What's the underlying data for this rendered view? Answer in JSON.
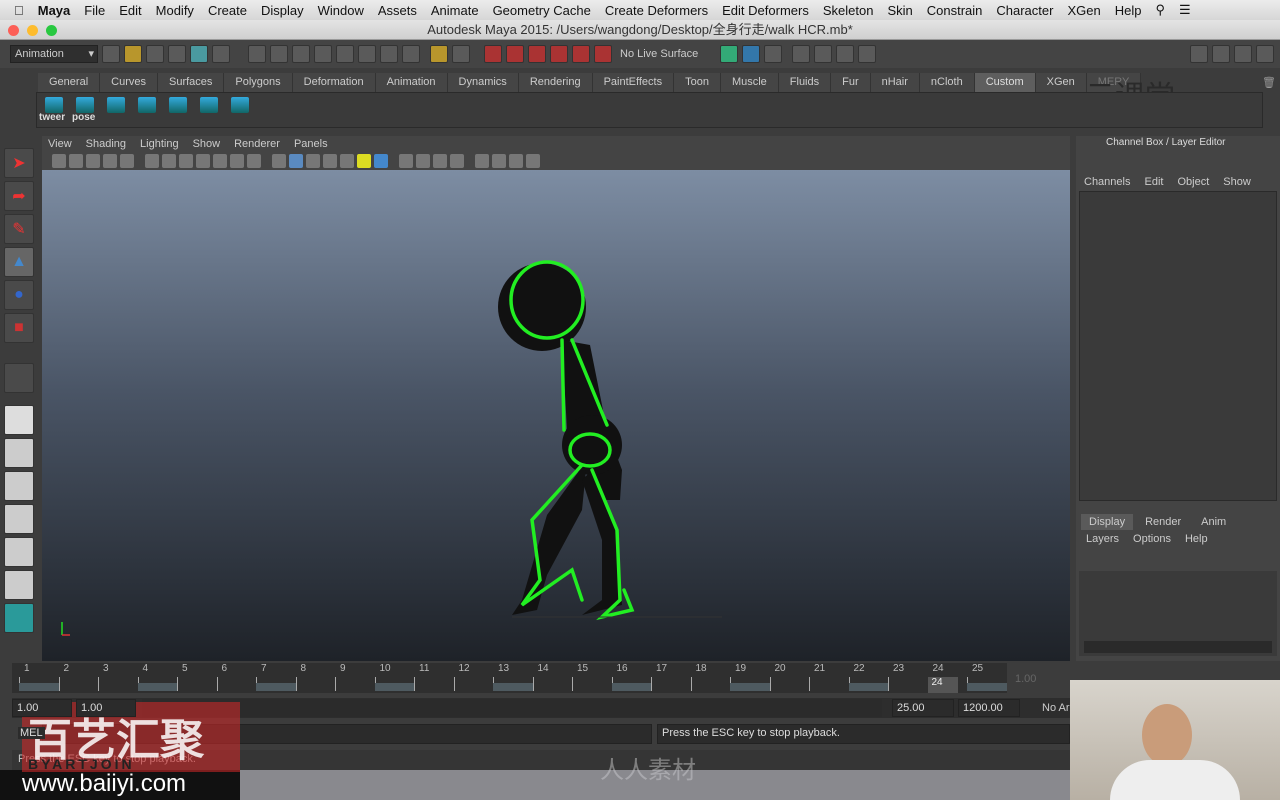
{
  "menubar": {
    "items": [
      "Maya",
      "File",
      "Edit",
      "Modify",
      "Create",
      "Display",
      "Window",
      "Assets",
      "Animate",
      "Geometry Cache",
      "Create Deformers",
      "Edit Deformers",
      "Skeleton",
      "Skin",
      "Constrain",
      "Character",
      "XGen",
      "Help"
    ]
  },
  "window": {
    "title": "Autodesk Maya 2015: /Users/wangdong/Desktop/全身行走/walk HCR.mb*"
  },
  "status": {
    "menuset": "Animation",
    "live_surface": "No Live Surface"
  },
  "shelf": {
    "tabs": [
      "General",
      "Curves",
      "Surfaces",
      "Polygons",
      "Deformation",
      "Animation",
      "Dynamics",
      "Rendering",
      "PaintEffects",
      "Toon",
      "Muscle",
      "Fluids",
      "Fur",
      "nHair",
      "nCloth",
      "Custom",
      "XGen",
      "MERY"
    ],
    "active": "Custom",
    "labels": [
      "tweer",
      "pose"
    ]
  },
  "panel": {
    "menu": [
      "View",
      "Shading",
      "Lighting",
      "Show",
      "Renderer",
      "Panels"
    ]
  },
  "channel_box": {
    "title": "Channel Box / Layer Editor",
    "menu": [
      "Channels",
      "Edit",
      "Object",
      "Show"
    ],
    "layer_tabs": [
      "Display",
      "Render",
      "Anim"
    ],
    "layer_menu": [
      "Layers",
      "Options",
      "Help"
    ]
  },
  "timeline": {
    "ticks": [
      "1",
      "2",
      "3",
      "4",
      "5",
      "6",
      "7",
      "8",
      "9",
      "10",
      "11",
      "12",
      "13",
      "14",
      "15",
      "16",
      "17",
      "18",
      "19",
      "20",
      "21",
      "22",
      "23",
      "24",
      "25"
    ],
    "current_frame": "24",
    "current_field": "1.00"
  },
  "range": {
    "start": "1.00",
    "inner_start": "1.00",
    "end": "25.00",
    "total_end": "1200.00",
    "anim_layer": "No Ar"
  },
  "command": {
    "label": "MEL",
    "response": "Press the ESC key to stop playback."
  },
  "helpline": {
    "text": "Press the ESC key to stop playback."
  },
  "watermarks": [
    "云课堂",
    "百艺汇聚",
    "BYARTJOIN",
    "www.baiiyi.com",
    "人人素材"
  ],
  "colors": {
    "skeleton": "#22ee22",
    "viewport_top": "#7d8da3",
    "viewport_bottom": "#1e2228"
  }
}
